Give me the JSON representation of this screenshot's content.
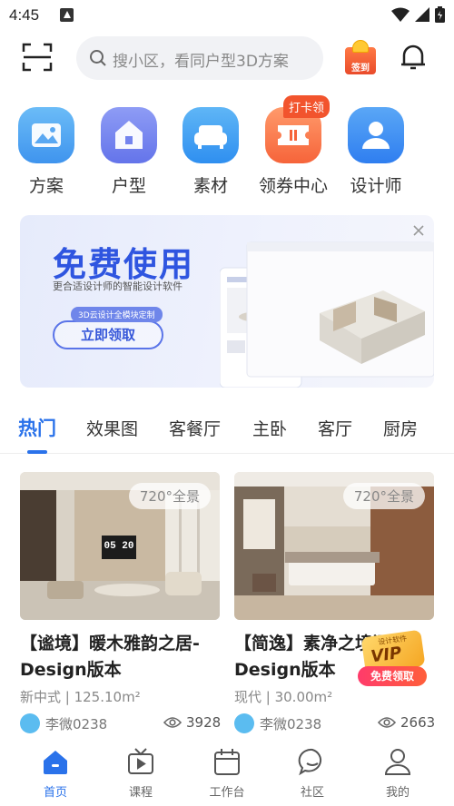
{
  "status_bar": {
    "time": "4:45"
  },
  "header": {
    "search_placeholder": "搜小区，看同户型3D方案",
    "signin_label": "签到"
  },
  "categories": [
    {
      "label": "方案",
      "color": "#4aa3f0"
    },
    {
      "label": "户型",
      "color": "#6b7ff0"
    },
    {
      "label": "素材",
      "color": "#3d9cf2"
    },
    {
      "label": "领券中心",
      "color": "#ff7a4d",
      "badge": "打卡领"
    },
    {
      "label": "设计师",
      "color": "#3d8df2"
    }
  ],
  "banner": {
    "title": "免费使用",
    "subtitle": "更合适设计师的智能设计软件",
    "tag": "3D云设计全模块定制",
    "cta": "立即领取"
  },
  "tabs": [
    "热门",
    "效果图",
    "客餐厅",
    "主卧",
    "客厅",
    "厨房"
  ],
  "cards": [
    {
      "badge": "720°全景",
      "title": "【谧境】暖木雅韵之居-Design版本",
      "meta": "新中式 | 125.10m²",
      "author": "李微0238",
      "views": "3928",
      "tv_clock": "05 20"
    },
    {
      "badge": "720°全景",
      "title": "【简逸】素净之境间-Design版本",
      "meta": "现代 | 30.00m²",
      "author": "李微0238",
      "views": "2663"
    }
  ],
  "vip_promo": {
    "corner": "设计软件",
    "vip": "VIP",
    "button": "免费领取"
  },
  "bottom_nav": [
    {
      "label": "首页",
      "icon": "home-icon",
      "active": true
    },
    {
      "label": "课程",
      "icon": "video-icon",
      "active": false
    },
    {
      "label": "工作台",
      "icon": "calendar-icon",
      "active": false
    },
    {
      "label": "社区",
      "icon": "chat-icon",
      "active": false
    },
    {
      "label": "我的",
      "icon": "user-icon",
      "active": false
    }
  ],
  "colors": {
    "accent": "#2a72ea",
    "promo": "#f2542d"
  }
}
